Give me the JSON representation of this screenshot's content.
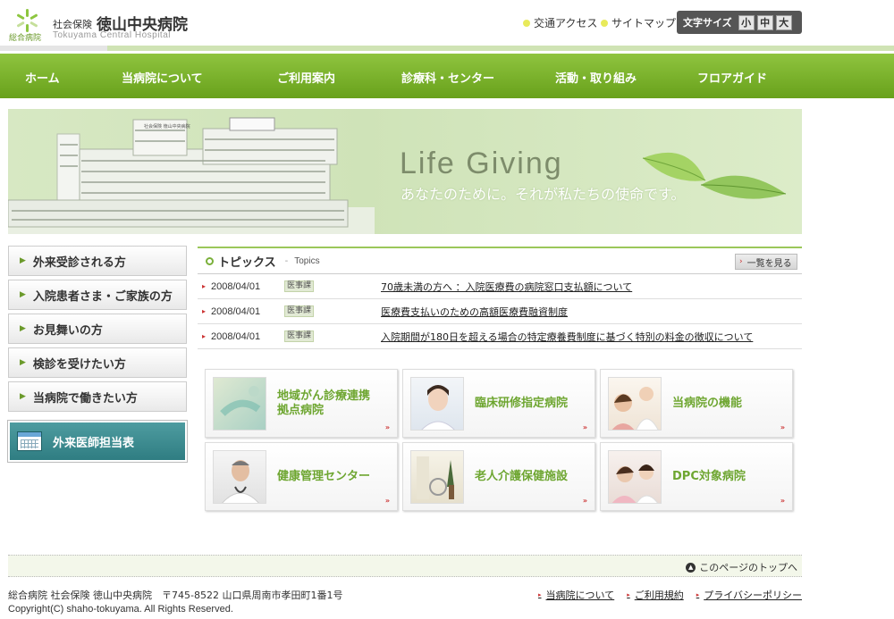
{
  "header": {
    "logo_label": "総合病院",
    "brand_sub": "社会保険",
    "brand_name": "徳山中央病院",
    "brand_en": "Tokuyama Central Hospital",
    "util_links": [
      "交通アクセス",
      "サイトマップ"
    ],
    "fontsize_label": "文字サイズ",
    "fontsize_options": [
      "小",
      "中",
      "大"
    ]
  },
  "nav": [
    "ホーム",
    "当病院について",
    "ご利用案内",
    "診療科・センター",
    "活動・取り組み",
    "フロアガイド"
  ],
  "hero": {
    "title": "Life Giving",
    "subtitle": "あなたのために。それが私たちの使命です。",
    "building_sign": "社会保険 徳山中央病院"
  },
  "side_menu": [
    "外来受診される方",
    "入院患者さま・ご家族の方",
    "お見舞いの方",
    "検診を受けたい方",
    "当病院で働きたい方"
  ],
  "doctor_schedule": "外来医師担当表",
  "topics": {
    "title": "トピックス",
    "sep": "-",
    "title_en": "Topics",
    "more": "一覧を見る",
    "items": [
      {
        "date": "2008/04/01",
        "tag": "医事課",
        "text": "70歳未満の方へ ：入院医療費の病院窓口支払額について"
      },
      {
        "date": "2008/04/01",
        "tag": "医事課",
        "text": "医療費支払いのための高額医療費融資制度"
      },
      {
        "date": "2008/04/01",
        "tag": "医事課",
        "text": "入院期間が180日を超える場合の特定療養費制度に基づく特別の料金の徴収について"
      }
    ]
  },
  "banners": [
    {
      "line1": "地域がん診療連携",
      "line2": "拠点病院"
    },
    {
      "line1": "臨床研修指定病院",
      "line2": ""
    },
    {
      "line1": "当病院の機能",
      "line2": ""
    },
    {
      "line1": "健康管理センター",
      "line2": ""
    },
    {
      "line1": "老人介護保健施設",
      "line2": ""
    },
    {
      "line1": "DPC対象病院",
      "line2": ""
    }
  ],
  "banner_more": "»",
  "footer": {
    "to_top": "このページのトップへ",
    "address": "総合病院 社会保険 徳山中央病院　〒745-8522 山口県周南市孝田町1番1号",
    "copyright": "Copyright(C) shaho-tokuyama. All Rights Reserved.",
    "links": [
      "当病院について",
      "ご利用規約",
      "プライバシーポリシー"
    ]
  },
  "colors": {
    "nav_green": "#7ab32e",
    "accent_green": "#6ea631",
    "teal": "#3a8a8f",
    "marker_red": "#cc3333"
  }
}
